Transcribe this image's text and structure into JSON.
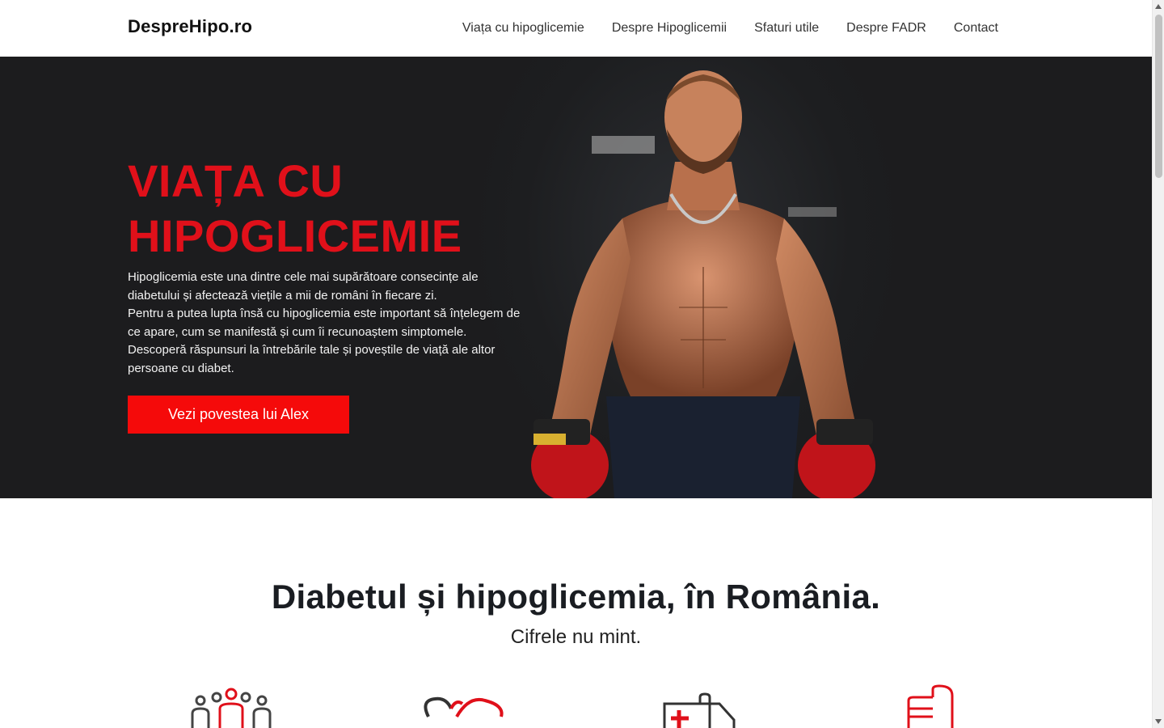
{
  "header": {
    "logo": "DespreHipo.ro",
    "nav": [
      {
        "label": "Viața cu hipoglicemie"
      },
      {
        "label": "Despre Hipoglicemii"
      },
      {
        "label": "Sfaturi utile"
      },
      {
        "label": "Despre FADR"
      },
      {
        "label": "Contact"
      }
    ]
  },
  "hero": {
    "title": "VIAȚA CU HIPOGLICEMIE",
    "paragraphs": [
      "Hipoglicemia este una dintre cele mai supărătoare consecințe ale diabetului și afectează viețile a mii de români în fiecare zi.",
      "Pentru a putea lupta însă cu hipoglicemia este important să înțelegem de ce apare, cum se manifestă și cum îi recunoaștem simptomele.",
      "Descoperă răspunsuri la întrebările tale și poveștile de viață ale altor persoane cu diabet."
    ],
    "button_label": "Vezi povestea lui Alex"
  },
  "stats": {
    "title": "Diabetul și hipoglicemia, în România.",
    "subtitle": "Cifrele nu mint.",
    "icons": [
      "people-group-icon",
      "hearts-icon",
      "ambulance-icon",
      "document-icon"
    ]
  },
  "colors": {
    "accent": "#e0101a",
    "button": "#f50a0a",
    "hero_bg": "#1c1c1e"
  }
}
